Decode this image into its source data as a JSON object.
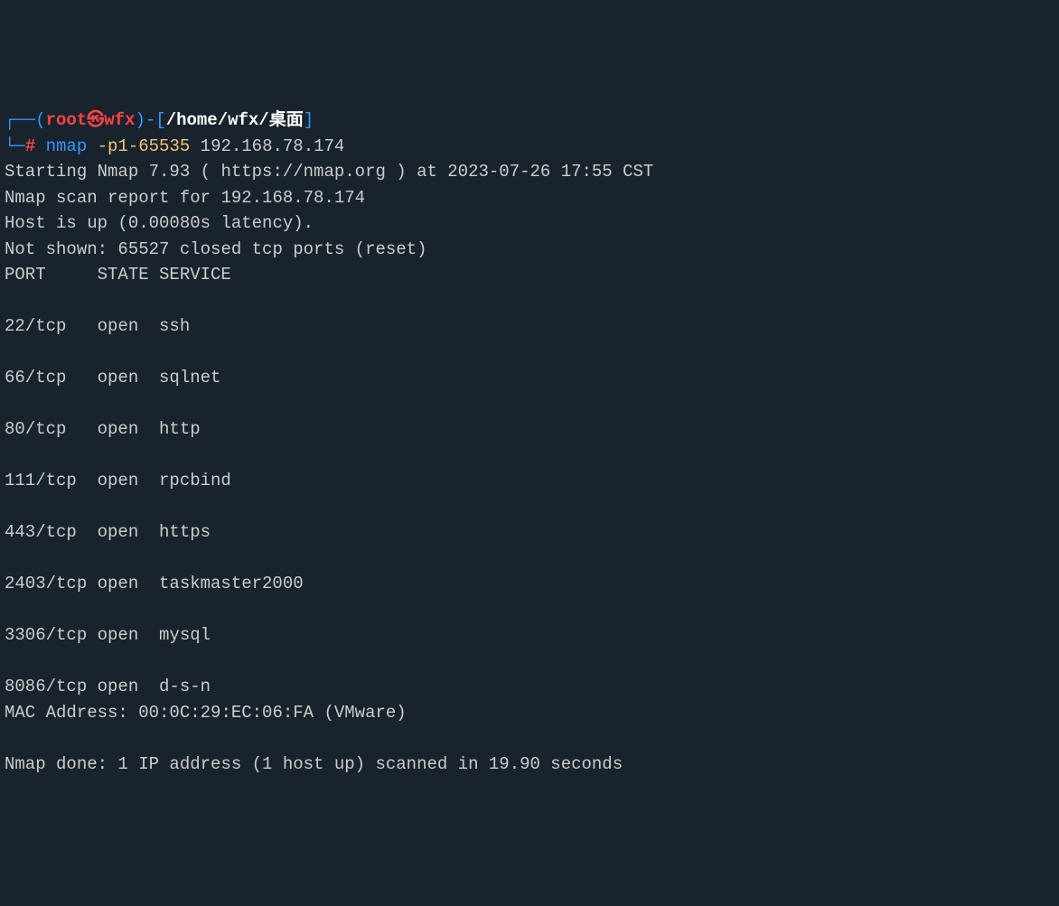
{
  "prompt": {
    "open_paren": "(",
    "user": "root",
    "symbol": "㉿",
    "host": "wfx",
    "close_paren": ")-[",
    "path": "/home/wfx/桌面",
    "close_bracket": "]",
    "prompt_char": "#"
  },
  "command": {
    "cmd": "nmap",
    "args": "-p1-65535",
    "target": "192.168.78.174"
  },
  "output": {
    "starting": "Starting Nmap 7.93 ( https://nmap.org ) at 2023-07-26 17:55 CST",
    "scan_report": "Nmap scan report for 192.168.78.174",
    "host_up": "Host is up (0.00080s latency).",
    "not_shown": "Not shown: 65527 closed tcp ports (reset)",
    "header": {
      "port": "PORT",
      "state": "STATE",
      "service": "SERVICE"
    },
    "ports": [
      {
        "port": "22/tcp",
        "state": "open",
        "service": "ssh"
      },
      {
        "port": "66/tcp",
        "state": "open",
        "service": "sqlnet"
      },
      {
        "port": "80/tcp",
        "state": "open",
        "service": "http"
      },
      {
        "port": "111/tcp",
        "state": "open",
        "service": "rpcbind"
      },
      {
        "port": "443/tcp",
        "state": "open",
        "service": "https"
      },
      {
        "port": "2403/tcp",
        "state": "open",
        "service": "taskmaster2000"
      },
      {
        "port": "3306/tcp",
        "state": "open",
        "service": "mysql"
      },
      {
        "port": "8086/tcp",
        "state": "open",
        "service": "d-s-n"
      }
    ],
    "mac": "MAC Address: 00:0C:29:EC:06:FA (VMware)",
    "done": "Nmap done: 1 IP address (1 host up) scanned in 19.90 seconds"
  }
}
